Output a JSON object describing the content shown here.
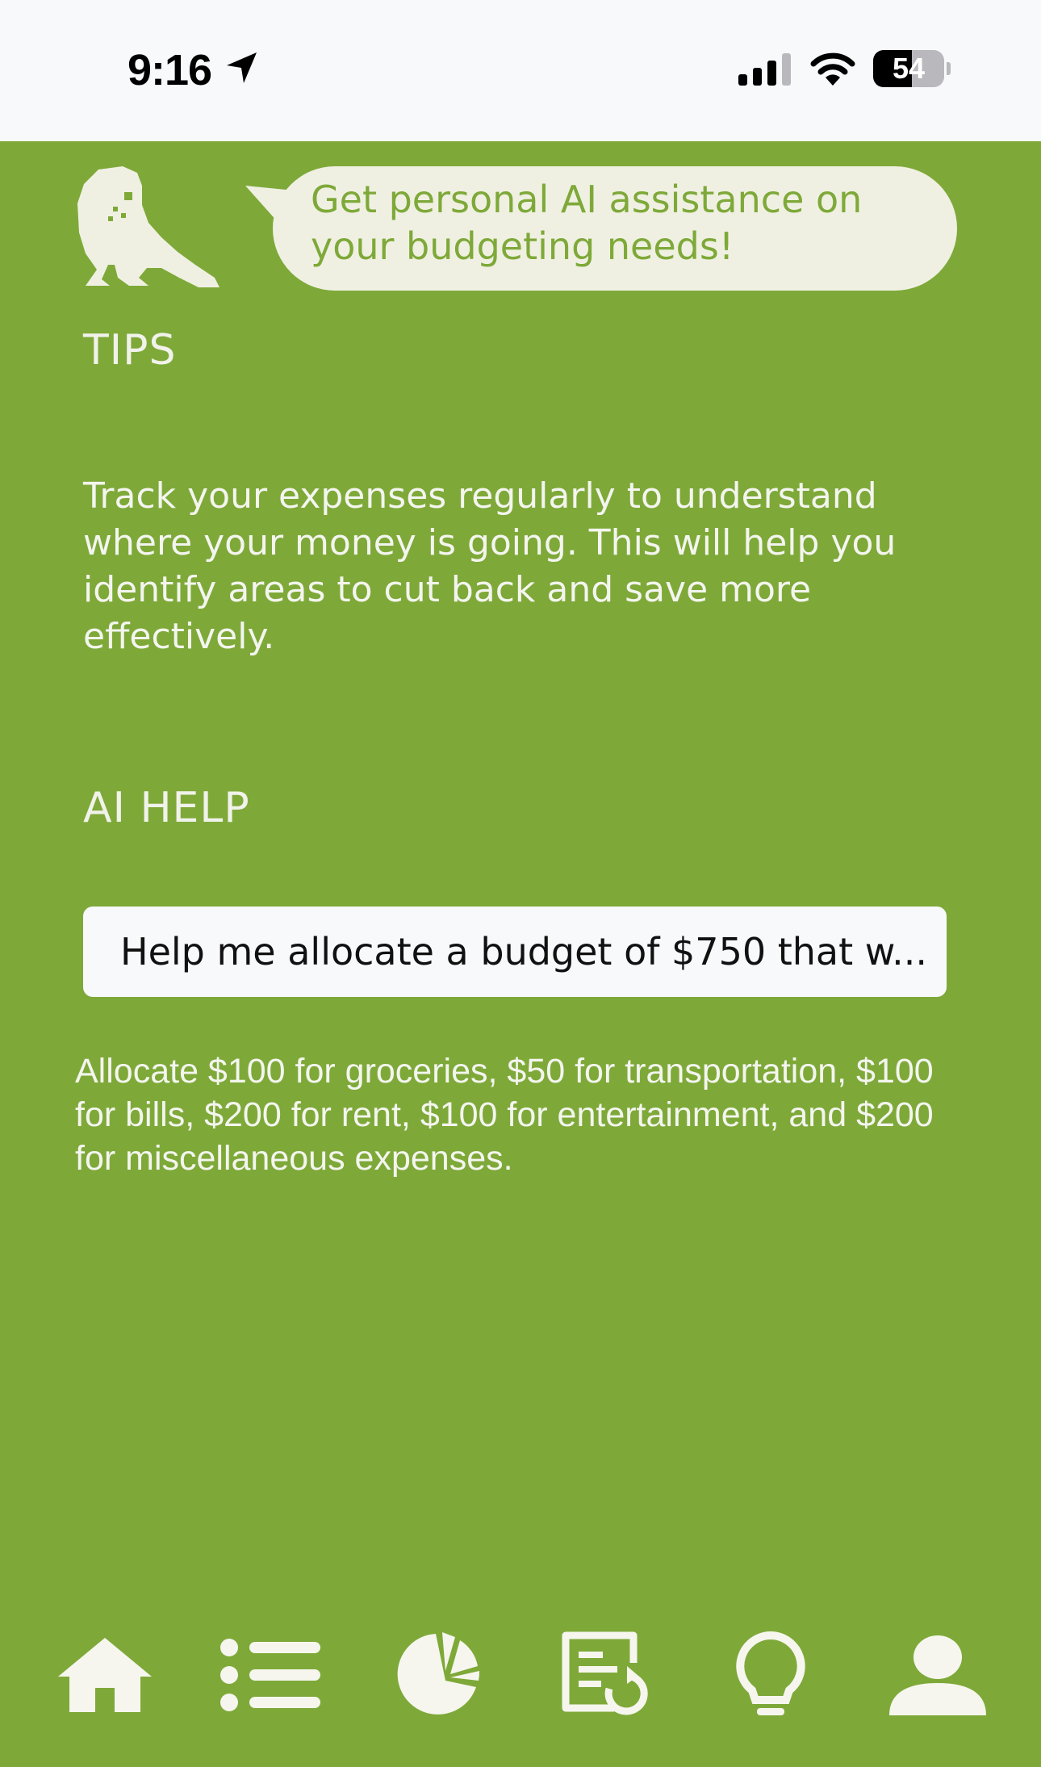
{
  "status_bar": {
    "time": "9:16",
    "battery_level": 54,
    "battery_label": "54",
    "icons": [
      "location-arrow-icon",
      "signal-icon",
      "wifi-icon",
      "battery-icon"
    ]
  },
  "header": {
    "mascot_icon": "bird-icon",
    "bubble_text": "Get personal AI assistance on your budgeting needs!"
  },
  "tips": {
    "title": "TIPS",
    "text": "Track your expenses regularly to understand where your money is going. This will help you identify areas to cut back and save more effectively."
  },
  "ai_help": {
    "title": "AI HELP",
    "input_value": "Help me allocate a budget of $750 that w...",
    "response": "Allocate $100 for groceries, $50 for transportation, $100 for bills, $200 for rent, $100 for entertainment, and $200 for miscellaneous expenses."
  },
  "tab_bar": {
    "tabs": [
      "home-icon",
      "list-icon",
      "pie-chart-icon",
      "recurring-bills-icon",
      "lightbulb-icon",
      "profile-icon"
    ]
  },
  "colors": {
    "background": "#7EA939",
    "bubble": "#F0F0E2",
    "text_light": "#F4F5EF",
    "status_bar": "#F8F9FB"
  }
}
